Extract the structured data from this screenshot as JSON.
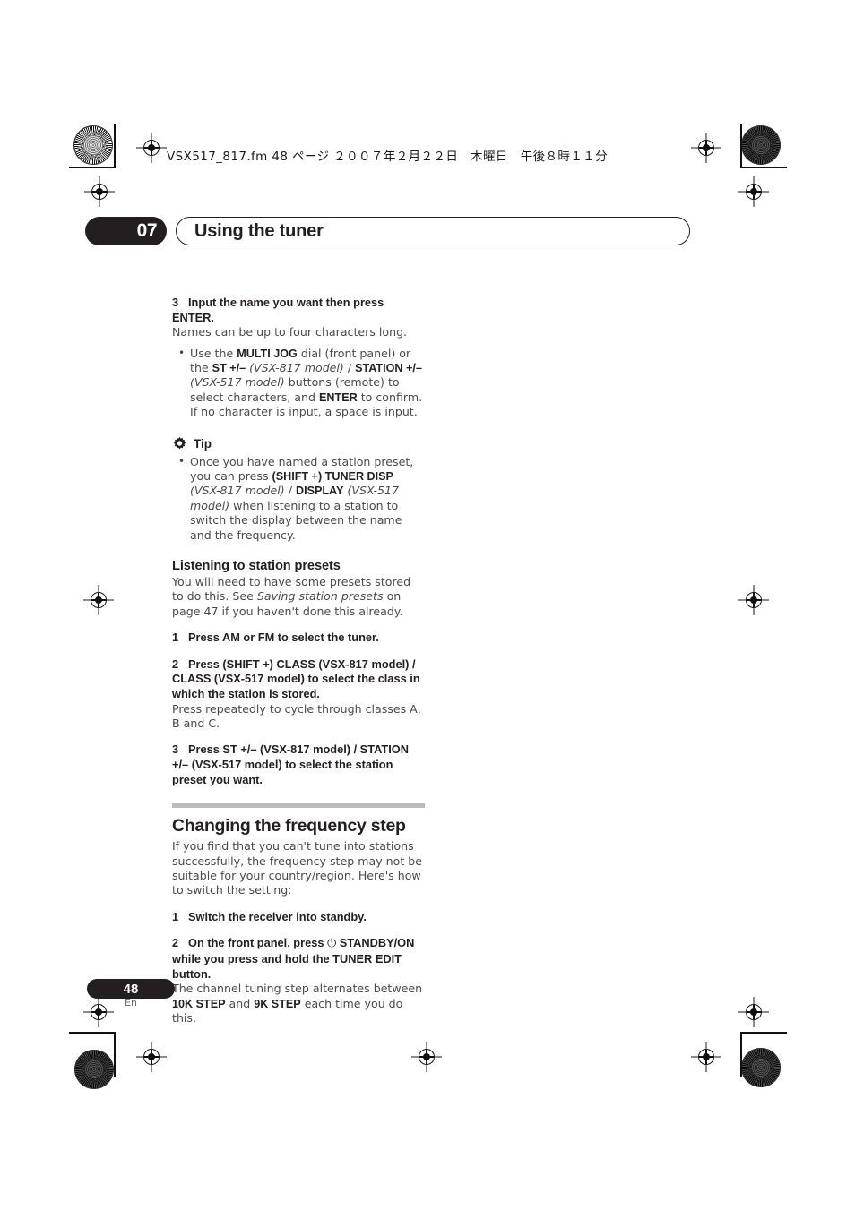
{
  "print_marks": {
    "file_info": "VSX517_817.fm  48 ページ  ２００７年２月２２日　木曜日　午後８時１１分"
  },
  "header": {
    "chapter_number": "07",
    "chapter_title": "Using the tuner"
  },
  "content": {
    "step3_name": {
      "num": "3",
      "title": "Input the name you want then press ENTER.",
      "body": "Names can be up to four characters long.",
      "bullet_html": "Use the <b>MULTI JOG</b> dial (front panel) or the <b>ST +/–</b> <i>(VSX-817 model)</i> / <b>STATION +/–</b> <i>(VSX-517 model)</i> buttons (remote) to select characters, and <b>ENTER</b> to confirm. If no character is input, a space is input."
    },
    "tip": {
      "label": "Tip",
      "icon": "gear-icon",
      "bullet_html": "Once you have named a station preset, you can press <b>(SHIFT +) TUNER DISP</b> <i>(VSX-817 model)</i> / <b>DISPLAY</b> <i>(VSX-517 model)</i> when listening to a station to switch the display between the name and the frequency."
    },
    "listening_section": {
      "heading": "Listening to station presets",
      "intro_html": "You will need to have some presets stored to do this. See <i>Saving station presets</i> on page 47 if you haven't done this already.",
      "steps": [
        {
          "num": "1",
          "title": "Press AM or FM to select the tuner.",
          "body": ""
        },
        {
          "num": "2",
          "title": "Press (SHIFT +) CLASS (VSX-817 model) / CLASS (VSX-517 model) to select the class in which the station is stored.",
          "body": "Press repeatedly to cycle through classes A, B and C."
        },
        {
          "num": "3",
          "title": "Press ST +/– (VSX-817 model) / STATION +/– (VSX-517 model) to select the station preset you want.",
          "body": ""
        }
      ]
    },
    "frequency_section": {
      "heading": "Changing the frequency step",
      "intro": "If you find that you can't tune into stations successfully, the frequency step may not be suitable for your country/region. Here's how to switch the setting:",
      "steps": [
        {
          "num": "1",
          "title_html": "Switch the receiver into standby.",
          "body_html": ""
        },
        {
          "num": "2",
          "title_html": "On the front panel, press <span class=\"power-glyph\">⏻</span> STANDBY/ON while you press and hold the TUNER EDIT button.",
          "body_html": "The channel tuning step alternates between <b>10K STEP</b> and <b>9K STEP</b> each time you do this."
        }
      ]
    }
  },
  "footer": {
    "page_number": "48",
    "language": "En"
  },
  "colors": {
    "ink": "#231f20",
    "body_gray": "#4a4a4a",
    "rule_gray": "#bcbcbc"
  }
}
